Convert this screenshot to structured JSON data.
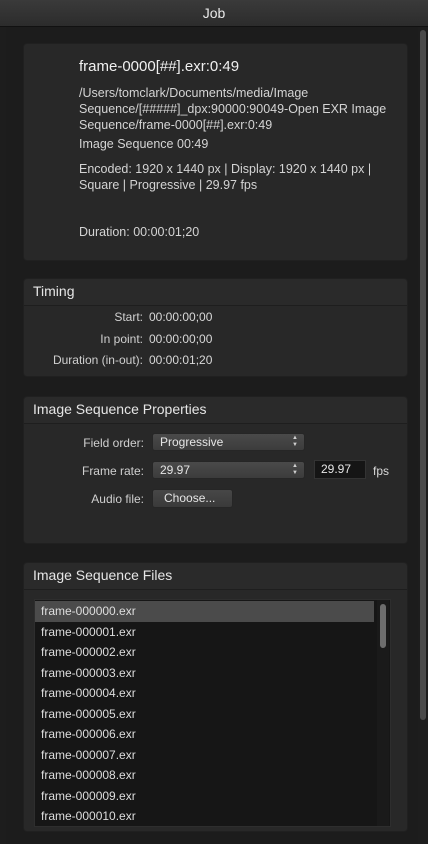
{
  "window": {
    "title": "Job"
  },
  "info": {
    "title": "frame-0000[##].exr:0:49",
    "path": "/Users/tomclark/Documents/media/Image Sequence/[#####]_dpx:90000:90049-Open EXR Image Sequence/frame-0000[##].exr:0:49",
    "type": "Image Sequence 00:49",
    "encoding": "Encoded: 1920 x 1440 px | Display: 1920 x 1440 px | Square | Progressive | 29.97 fps",
    "duration": "Duration: 00:00:01;20"
  },
  "timing": {
    "header": "Timing",
    "start_label": "Start:",
    "start_value": "00:00:00;00",
    "in_label": "In point:",
    "in_value": "00:00:00;00",
    "dur_label": "Duration (in-out):",
    "dur_value": "00:00:01;20"
  },
  "properties": {
    "header": "Image Sequence Properties",
    "field_order_label": "Field order:",
    "field_order_value": "Progressive",
    "frame_rate_label": "Frame rate:",
    "frame_rate_value": "29.97",
    "frame_rate_custom": "29.97",
    "fps_unit": "fps",
    "audio_label": "Audio file:",
    "choose_label": "Choose..."
  },
  "files": {
    "header": "Image Sequence Files",
    "items": [
      "frame-000000.exr",
      "frame-000001.exr",
      "frame-000002.exr",
      "frame-000003.exr",
      "frame-000004.exr",
      "frame-000005.exr",
      "frame-000006.exr",
      "frame-000007.exr",
      "frame-000008.exr",
      "frame-000009.exr",
      "frame-000010.exr"
    ],
    "selected_index": 0
  }
}
